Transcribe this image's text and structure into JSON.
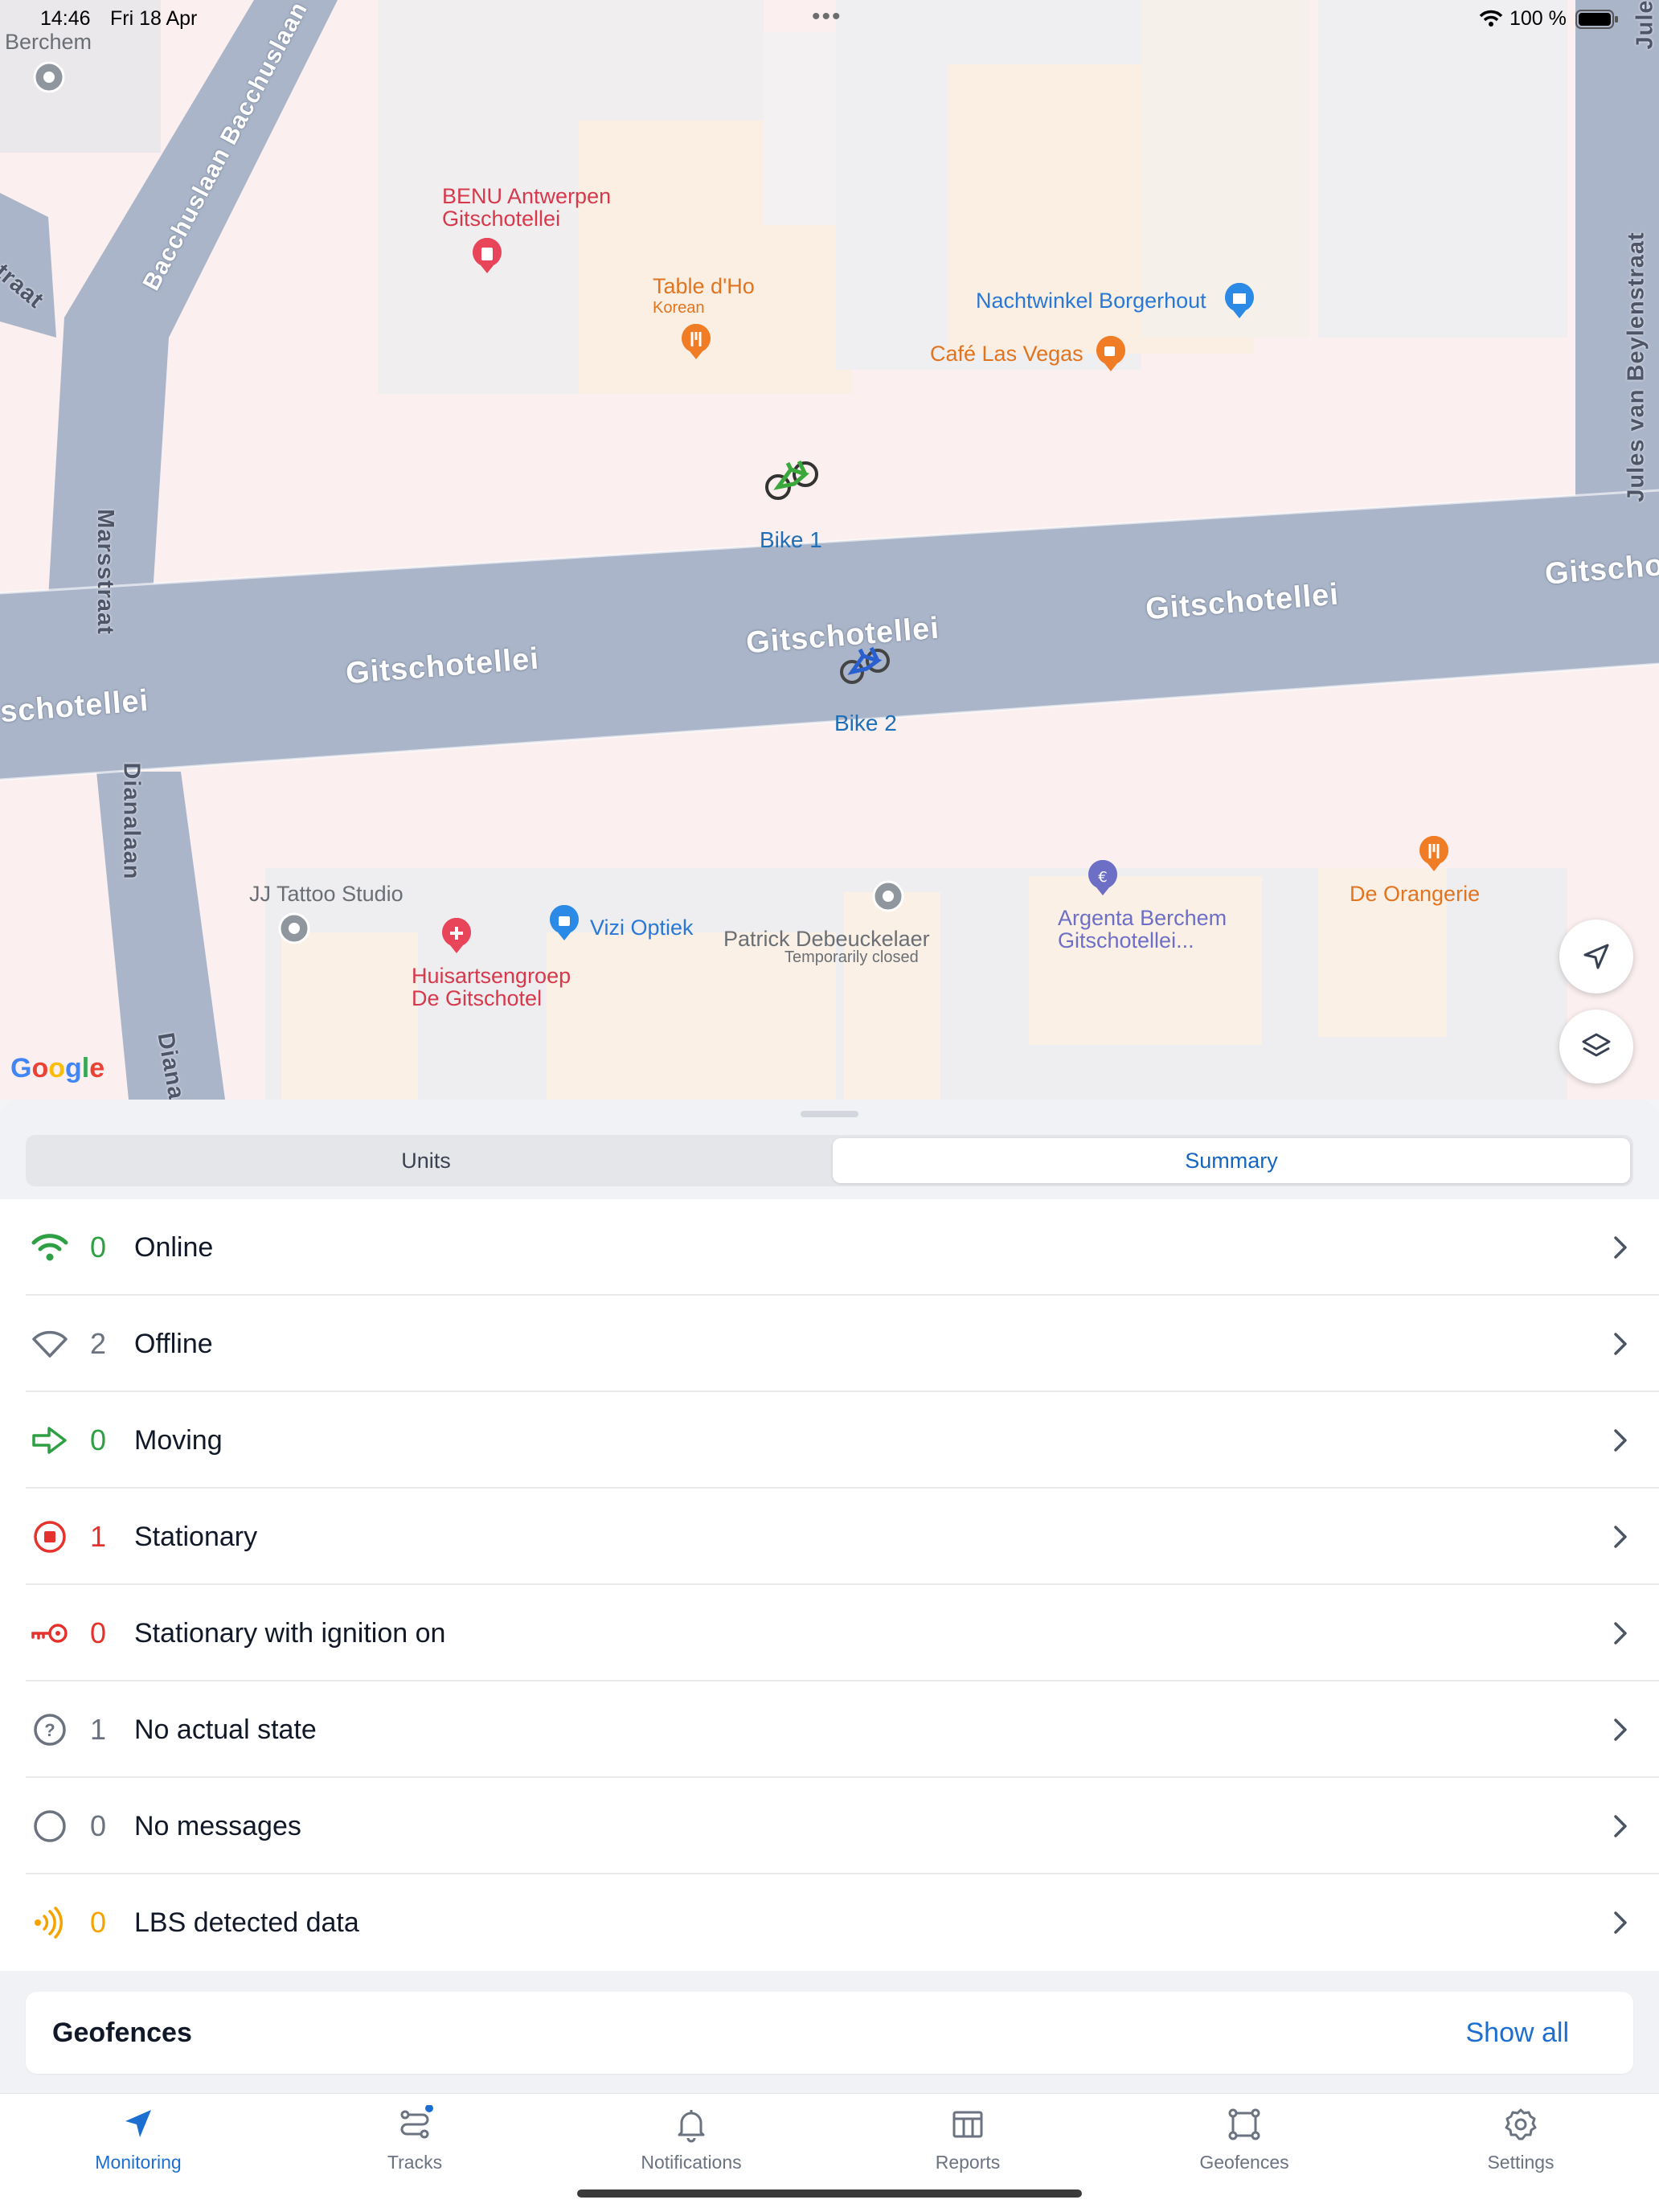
{
  "status_bar": {
    "time": "14:46",
    "date": "Fri 18 Apr",
    "battery": "100 %"
  },
  "map": {
    "streets": {
      "gitschotellei": "Gitschotellei",
      "gitschotellei_left": "schotellei",
      "gitschotellei_right": "Gitscho",
      "bacchuslaan": "Bacchuslaan Bacchuslaan",
      "marsstraat": "Marsstraat",
      "dianalaan": "Dianalaan",
      "diana_cut": "Diana",
      "jules": "Jules van Beylenstraat",
      "jules_top": "Jule",
      "straat_cut": "traat"
    },
    "places": {
      "berchem": "Berchem",
      "benu_1": "BENU Antwerpen",
      "benu_2": "Gitschotellei",
      "table_dho": "Table d'Ho",
      "table_dho_sub": "Korean",
      "nachtwinkel": "Nachtwinkel Borgerhout",
      "cafe": "Café Las Vegas",
      "jj_tattoo": "JJ Tattoo Studio",
      "huisarts_1": "Huisartsengroep",
      "huisarts_2": "De Gitschotel",
      "vizi": "Vizi Optiek",
      "patrick": "Patrick Debeuckelaer",
      "patrick_sub": "Temporarily closed",
      "argenta_1": "Argenta Berchem",
      "argenta_2": "Gitschotellei...",
      "orangerie": "De Orangerie"
    },
    "units": [
      {
        "name": "Bike 1",
        "color": "#3aa83a"
      },
      {
        "name": "Bike 2",
        "color": "#2a5fd0"
      }
    ],
    "google_logo": "Google"
  },
  "sheet": {
    "tabs": [
      {
        "label": "Units",
        "active": false
      },
      {
        "label": "Summary",
        "active": true
      }
    ],
    "summary_rows": [
      {
        "icon": "wifi-icon",
        "count": "0",
        "label": "Online",
        "color": "#2ea043"
      },
      {
        "icon": "wifi-off-icon",
        "count": "2",
        "label": "Offline",
        "color": "#6b7280"
      },
      {
        "icon": "arrow-right-icon",
        "count": "0",
        "label": "Moving",
        "color": "#2ea043"
      },
      {
        "icon": "stop-circle-icon",
        "count": "1",
        "label": "Stationary",
        "color": "#e5322d"
      },
      {
        "icon": "key-icon",
        "count": "0",
        "label": "Stationary with ignition on",
        "color": "#e5322d"
      },
      {
        "icon": "question-circle-icon",
        "count": "1",
        "label": "No actual state",
        "color": "#6b7280"
      },
      {
        "icon": "empty-circle-icon",
        "count": "0",
        "label": "No messages",
        "color": "#6b7280"
      },
      {
        "icon": "lbs-signal-icon",
        "count": "0",
        "label": "LBS detected data",
        "color": "#f5a300"
      }
    ],
    "geofences": {
      "title": "Geofences",
      "show_all": "Show all"
    }
  },
  "tabbar": {
    "items": [
      {
        "label": "Monitoring",
        "icon": "navigation-arrow-icon",
        "active": true
      },
      {
        "label": "Tracks",
        "icon": "tracks-icon",
        "active": false,
        "badge": true
      },
      {
        "label": "Notifications",
        "icon": "bell-icon",
        "active": false
      },
      {
        "label": "Reports",
        "icon": "reports-icon",
        "active": false
      },
      {
        "label": "Geofences",
        "icon": "geofence-icon",
        "active": false
      },
      {
        "label": "Settings",
        "icon": "gear-icon",
        "active": false
      }
    ],
    "active_color": "#1c6fd0"
  }
}
